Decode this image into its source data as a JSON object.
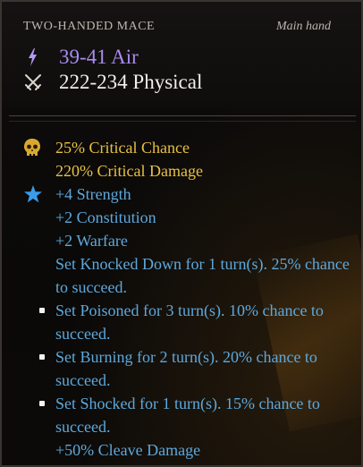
{
  "tooltip": {
    "item_type": "TWO-HANDED MACE",
    "slot": "Main hand",
    "damage": [
      {
        "icon": "lightning-icon",
        "text": "39-41 Air",
        "color": "#a98cf0"
      },
      {
        "icon": "crossed-swords-icon",
        "text": "222-234 Physical",
        "color": "#f2eee8"
      }
    ],
    "stats": {
      "critical_chance": "25% Critical Chance",
      "critical_damage": "220% Critical Damage",
      "strength": "+4 Strength",
      "constitution": "+2 Constitution",
      "warfare": "+2 Warfare",
      "knockdown": "Set Knocked Down for 1 turn(s). 25% chance to succeed.",
      "poisoned": "Set Poisoned for 3 turn(s). 10% chance to succeed.",
      "burning": "Set Burning for 2 turn(s). 20% chance to succeed.",
      "shocked": "Set Shocked for 1 turn(s). 15% chance to succeed.",
      "cleave": "+50% Cleave Damage"
    },
    "icons": {
      "critical": "skull-icon",
      "rune": "star-icon"
    },
    "colors": {
      "gold": "#e7c043",
      "blue": "#5ea8dc"
    }
  }
}
